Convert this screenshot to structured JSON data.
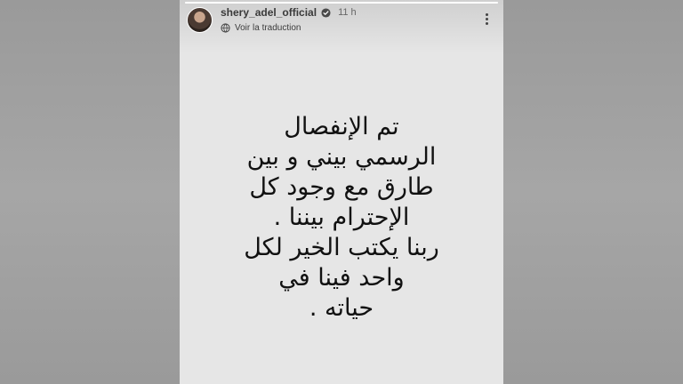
{
  "story": {
    "username": "shery_adel_official",
    "time_ago": "11 h",
    "translate_label": "Voir la traduction",
    "progress": 1.0,
    "lines": [
      "تم الإنفصال",
      "الرسمي بيني و بين",
      "طارق مع وجود كل",
      "الإحترام بيننا .",
      "ربنا يكتب الخير لكل",
      "واحد فينا في",
      "حياته ."
    ]
  },
  "colors": {
    "story_background": "#e6e6e6",
    "side_background": "#a0a0a0",
    "text": "#111111"
  },
  "icons": [
    "verified-badge-icon",
    "translate-icon",
    "more-options-icon"
  ]
}
